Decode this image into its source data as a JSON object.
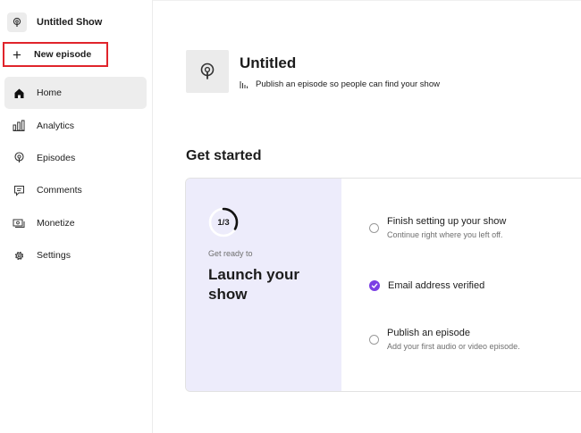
{
  "sidebar": {
    "show_name": "Untitled Show",
    "new_episode_label": "New episode",
    "items": [
      {
        "label": "Home",
        "icon": "home-icon",
        "active": true
      },
      {
        "label": "Analytics",
        "icon": "analytics-icon"
      },
      {
        "label": "Episodes",
        "icon": "podcast-icon"
      },
      {
        "label": "Comments",
        "icon": "comment-icon"
      },
      {
        "label": "Monetize",
        "icon": "money-icon"
      },
      {
        "label": "Settings",
        "icon": "gear-icon"
      }
    ]
  },
  "header": {
    "title": "Untitled",
    "subtitle": "Publish an episode so people can find your show"
  },
  "get_started": {
    "heading": "Get started",
    "progress_label": "1/3",
    "progress_fraction": 0.333,
    "kicker": "Get ready to",
    "headline": "Launch your show",
    "tasks": [
      {
        "title": "Finish setting up your show",
        "desc": "Continue right where you left off.",
        "done": false
      },
      {
        "title": "Email address verified",
        "desc": "",
        "done": true
      },
      {
        "title": "Publish an episode",
        "desc": "Add your first audio or video episode.",
        "done": false
      }
    ]
  },
  "colors": {
    "accent": "#7b3fe4",
    "highlight_border": "#e0242b",
    "card_left_bg": "#edecfb"
  }
}
